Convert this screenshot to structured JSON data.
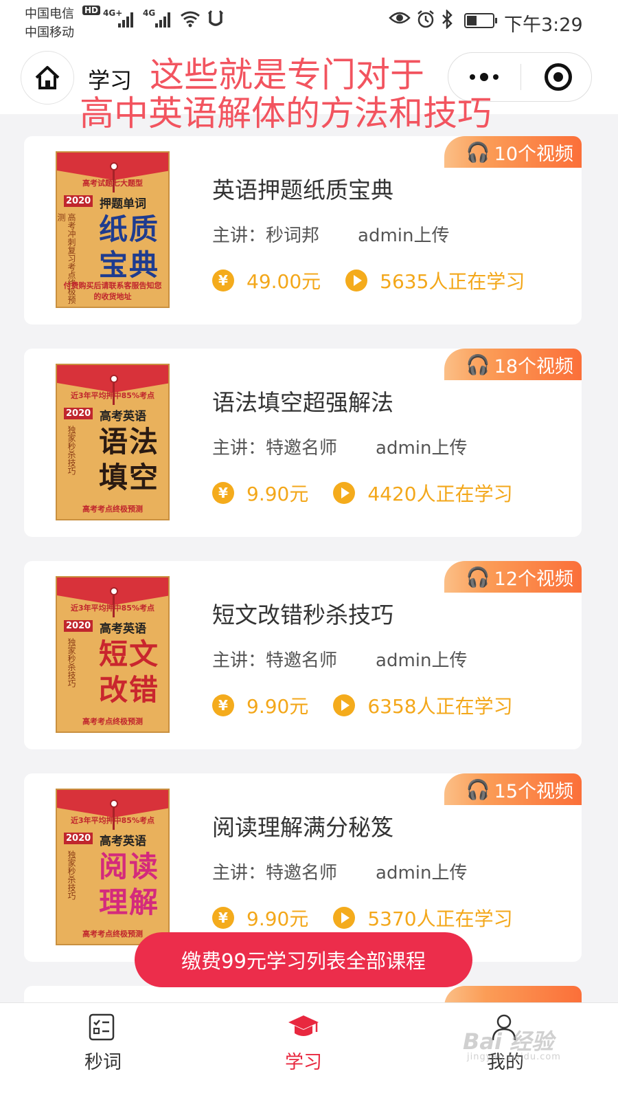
{
  "status_bar": {
    "carrier1": "中国电信",
    "carrier2": "中国移动",
    "hd": "HD",
    "net1": "4G+",
    "net2": "4G",
    "time": "下午3:29"
  },
  "nav": {
    "title": "学习"
  },
  "annotation": {
    "line1": "这些就是专门对于",
    "line2": "高中英语解体的方法和技巧"
  },
  "courses": [
    {
      "title": "英语押题纸质宝典",
      "teacher": "主讲：秒词邦",
      "uploader": "admin上传",
      "price": "49.00元",
      "learners": "5635人正在学习",
      "videos": "10个视频",
      "cover": {
        "top": "高考试题七大题型",
        "year": "2020",
        "sub": "押题单词",
        "vertical": "高考冲刺复习考点终极预测",
        "big1": "纸质",
        "big2": "宝典",
        "foot": "付费购买后请联系客服告知您的收货地址",
        "big_color": "#1f3c8f"
      }
    },
    {
      "title": "语法填空超强解法",
      "teacher": "主讲：特邀名师",
      "uploader": "admin上传",
      "price": "9.90元",
      "learners": "4420人正在学习",
      "videos": "18个视频",
      "cover": {
        "top": "近3年平均押中85%考点",
        "year": "2020",
        "sub": "高考英语",
        "vertical": "独家秒杀技巧",
        "big1": "语法",
        "big2": "填空",
        "foot": "高考考点终极预测",
        "big_color": "#2a1a12"
      }
    },
    {
      "title": "短文改错秒杀技巧",
      "teacher": "主讲：特邀名师",
      "uploader": "admin上传",
      "price": "9.90元",
      "learners": "6358人正在学习",
      "videos": "12个视频",
      "cover": {
        "top": "近3年平均押中85%考点",
        "year": "2020",
        "sub": "高考英语",
        "vertical": "独家秒杀技巧",
        "big1": "短文",
        "big2": "改错",
        "foot": "高考考点终极预测",
        "big_color": "#c9262e"
      }
    },
    {
      "title": "阅读理解满分秘笈",
      "teacher": "主讲：特邀名师",
      "uploader": "admin上传",
      "price": "9.90元",
      "learners": "5370人正在学习",
      "videos": "15个视频",
      "cover": {
        "top": "近3年平均押中85%考点",
        "year": "2020",
        "sub": "高考英语",
        "vertical": "独家秒杀技巧",
        "big1": "阅读",
        "big2": "理解",
        "foot": "高考考点终极预测",
        "big_color": "#d42a7c"
      }
    }
  ],
  "pay_button": "缴费99元学习列表全部课程",
  "tabs": [
    {
      "label": "秒词",
      "icon": "checklist-icon"
    },
    {
      "label": "学习",
      "icon": "graduation-cap-icon"
    },
    {
      "label": "我的",
      "icon": "user-icon"
    }
  ],
  "watermark": {
    "logo": "Bai 经验",
    "url": "jingyan.baidu.com"
  },
  "colors": {
    "accent": "#ec2d4b",
    "price": "#f3a71a",
    "annotation": "#f2545f"
  }
}
